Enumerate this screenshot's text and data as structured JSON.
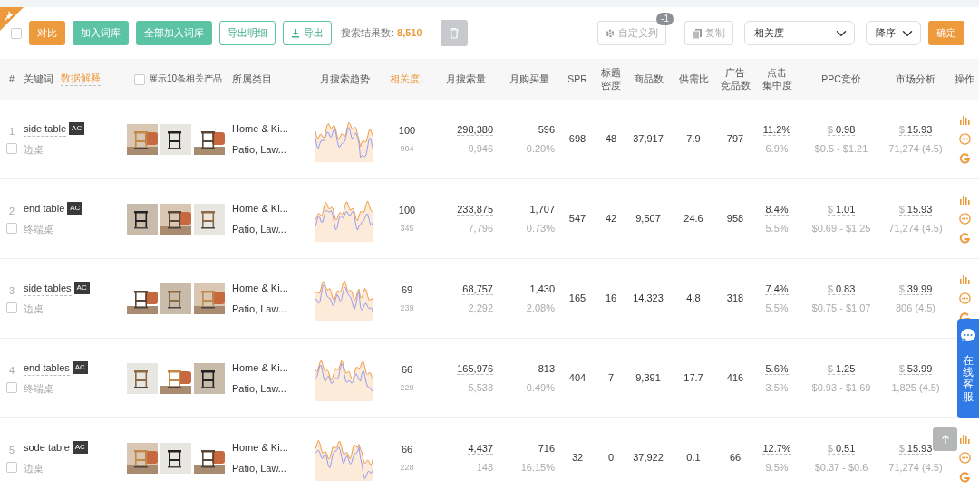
{
  "toolbar": {
    "select_all": {
      "checked": false
    },
    "buttons": [
      {
        "label": "对比",
        "kind": "orange"
      },
      {
        "label": "加入词库",
        "kind": "green"
      },
      {
        "label": "全部加入词库",
        "kind": "green"
      },
      {
        "label": "导出明细",
        "kind": "outline"
      },
      {
        "label": "导出",
        "kind": "outline-download"
      }
    ],
    "result_label": "搜索结果数:",
    "result_count": "8,510",
    "delete": {
      "disabled": true
    },
    "custom_columns": {
      "label": "自定义列",
      "badge": "-1"
    },
    "copy": {
      "label": "复制"
    },
    "sort_field": "相关度",
    "sort_order": "降序",
    "confirm": "确定"
  },
  "columns": [
    {
      "lines": [
        "#"
      ],
      "kind": "plain"
    },
    {
      "lines": [
        "关键词"
      ],
      "kind": "keyword",
      "link": "数据解释"
    },
    {
      "lines": [
        "展示10条相关产品"
      ],
      "kind": "checkbox",
      "checked": false
    },
    {
      "lines": [
        "所属类目"
      ],
      "kind": "plain"
    },
    {
      "lines": [
        "月搜索趋势"
      ],
      "kind": "plain"
    },
    {
      "lines": [
        "相关度"
      ],
      "kind": "sortable",
      "sorted": true,
      "arrow": "↓"
    },
    {
      "lines": [
        "月搜索量"
      ],
      "kind": "plain"
    },
    {
      "lines": [
        "月购买量"
      ],
      "kind": "plain"
    },
    {
      "lines": [
        "SPR"
      ],
      "kind": "plain"
    },
    {
      "lines": [
        "标题",
        "密度"
      ],
      "kind": "plain"
    },
    {
      "lines": [
        "商品数"
      ],
      "kind": "plain"
    },
    {
      "lines": [
        "供需比"
      ],
      "kind": "plain"
    },
    {
      "lines": [
        "广告",
        "竞品数"
      ],
      "kind": "plain"
    },
    {
      "lines": [
        "点击",
        "集中度"
      ],
      "kind": "plain"
    },
    {
      "lines": [
        "PPC竞价"
      ],
      "kind": "plain"
    },
    {
      "lines": [
        "市场分析"
      ],
      "kind": "plain"
    },
    {
      "lines": [
        "操作"
      ],
      "kind": "plain"
    }
  ],
  "rows": [
    {
      "index": "1",
      "keyword": "side table",
      "tag": "AC",
      "translation": "边桌",
      "checked": false,
      "images": [
        {
          "kind": "picture"
        },
        {
          "kind": "picture"
        },
        {
          "kind": "picture"
        }
      ],
      "categories": [
        "Home & Ki...",
        "Patio, Law..."
      ],
      "relevance": "100",
      "relevance_sub": "904",
      "search": "298,380",
      "search_sub": "9,946",
      "purchase": "596",
      "purchase_rate": "0.20%",
      "spr": "698",
      "title_density": "48",
      "products": "37,917",
      "supply_demand": "7.9",
      "ad_products": "797",
      "click": "11.2%",
      "click_sub": "6.9%",
      "ppc_currency": "$",
      "ppc": "0.98",
      "ppc_range": "$0.5 - $1.21",
      "price_currency": "$",
      "price": "15.93",
      "price_sub": "71,274 (4.5)",
      "actions": [
        {
          "kind": "chart"
        },
        {
          "kind": "more"
        },
        {
          "kind": "google"
        }
      ]
    },
    {
      "index": "2",
      "keyword": "end table",
      "tag": "AC",
      "translation": "终端桌",
      "checked": false,
      "images": [
        {
          "kind": "picture"
        },
        {
          "kind": "picture"
        },
        {
          "kind": "picture"
        }
      ],
      "categories": [
        "Home & Ki...",
        "Patio, Law..."
      ],
      "relevance": "100",
      "relevance_sub": "345",
      "search": "233,875",
      "search_sub": "7,796",
      "purchase": "1,707",
      "purchase_rate": "0.73%",
      "spr": "547",
      "title_density": "42",
      "products": "9,507",
      "supply_demand": "24.6",
      "ad_products": "958",
      "click": "8.4%",
      "click_sub": "5.5%",
      "ppc_currency": "$",
      "ppc": "1.01",
      "ppc_range": "$0.69 - $1.25",
      "price_currency": "$",
      "price": "15.93",
      "price_sub": "71,274 (4.5)",
      "actions": [
        {
          "kind": "chart"
        },
        {
          "kind": "more"
        },
        {
          "kind": "google"
        }
      ]
    },
    {
      "index": "3",
      "keyword": "side tables",
      "tag": "AC",
      "translation": "边桌",
      "checked": false,
      "images": [
        {
          "kind": "picture"
        },
        {
          "kind": "picture"
        },
        {
          "kind": "picture"
        }
      ],
      "categories": [
        "Home & Ki...",
        "Patio, Law..."
      ],
      "relevance": "69",
      "relevance_sub": "239",
      "search": "68,757",
      "search_sub": "2,292",
      "purchase": "1,430",
      "purchase_rate": "2.08%",
      "spr": "165",
      "title_density": "16",
      "products": "14,323",
      "supply_demand": "4.8",
      "ad_products": "318",
      "click": "7.4%",
      "click_sub": "5.5%",
      "ppc_currency": "$",
      "ppc": "0.83",
      "ppc_range": "$0.75 - $1.07",
      "price_currency": "$",
      "price": "39.99",
      "price_sub": "806 (4.5)",
      "actions": [
        {
          "kind": "chart"
        },
        {
          "kind": "more"
        },
        {
          "kind": "google"
        }
      ]
    },
    {
      "index": "4",
      "keyword": "end tables",
      "tag": "AC",
      "translation": "终端桌",
      "checked": false,
      "images": [
        {
          "kind": "picture"
        },
        {
          "kind": "picture"
        },
        {
          "kind": "picture"
        }
      ],
      "categories": [
        "Home & Ki...",
        "Patio, Law..."
      ],
      "relevance": "66",
      "relevance_sub": "229",
      "search": "165,976",
      "search_sub": "5,533",
      "purchase": "813",
      "purchase_rate": "0.49%",
      "spr": "404",
      "title_density": "7",
      "products": "9,391",
      "supply_demand": "17.7",
      "ad_products": "416",
      "click": "5.6%",
      "click_sub": "3.5%",
      "ppc_currency": "$",
      "ppc": "1.25",
      "ppc_range": "$0.93 - $1.69",
      "price_currency": "$",
      "price": "53.99",
      "price_sub": "1,825 (4.5)"
    },
    {
      "index": "5",
      "keyword": "sode table",
      "tag": "AC",
      "translation": "边桌",
      "checked": false,
      "images": [
        {
          "kind": "picture"
        },
        {
          "kind": "picture"
        },
        {
          "kind": "picture"
        }
      ],
      "categories": [
        "Home & Ki...",
        "Patio, Law..."
      ],
      "relevance": "66",
      "relevance_sub": "228",
      "search": "4,437",
      "search_sub": "148",
      "purchase": "716",
      "purchase_rate": "16.15%",
      "spr": "32",
      "title_density": "0",
      "products": "37,922",
      "supply_demand": "0.1",
      "ad_products": "66",
      "click": "12.7%",
      "click_sub": "9.5%",
      "ppc_currency": "$",
      "ppc": "0.51",
      "ppc_range": "$0.37 - $0.6",
      "price_currency": "$",
      "price": "15.93",
      "price_sub": "71,274 (4.5)",
      "actions": [
        {
          "kind": "chart"
        },
        {
          "kind": "more"
        },
        {
          "kind": "google"
        }
      ]
    }
  ],
  "chat_widget": {
    "label": "在线客服"
  }
}
